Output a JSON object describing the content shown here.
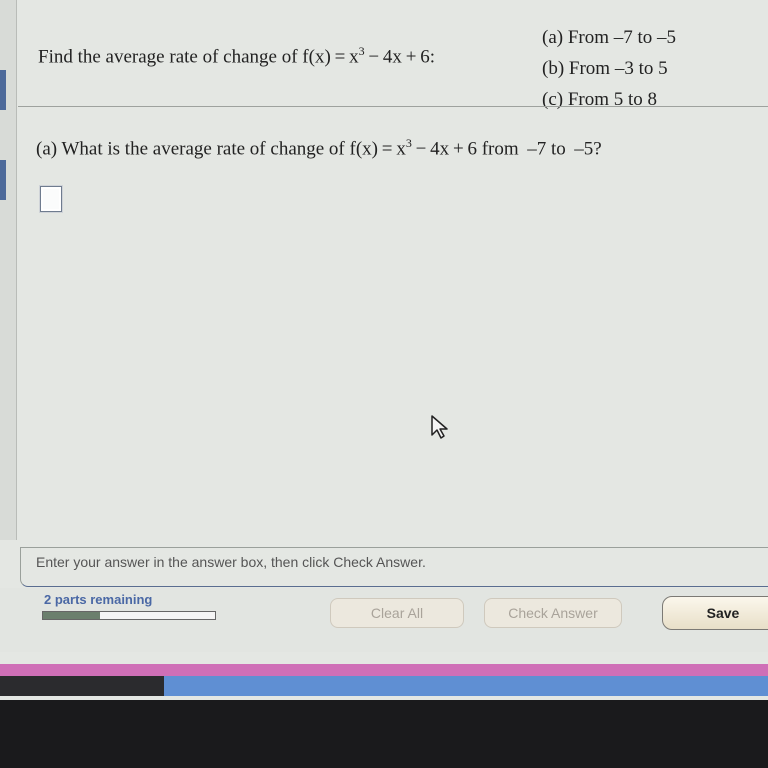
{
  "problem": {
    "prefix": "Find the average rate of change of f(x) = x",
    "exponent": "3",
    "suffix": " − 4x + 6:",
    "parts": [
      "(a) From –7 to –5",
      "(b) From –3 to 5",
      "(c) From 5 to 8"
    ]
  },
  "question": {
    "prefix": "(a) What is the average rate of change of f(x) = x",
    "exponent": "3",
    "suffix": " − 4x + 6 from  –7 to  –5?"
  },
  "answer": {
    "value": ""
  },
  "hint": "Enter your answer in the answer box, then click Check Answer.",
  "footer": {
    "parts_remaining": "2 parts remaining",
    "progress": 0.33,
    "clear_all": "Clear All",
    "check_answer": "Check Answer",
    "save": "Save"
  }
}
